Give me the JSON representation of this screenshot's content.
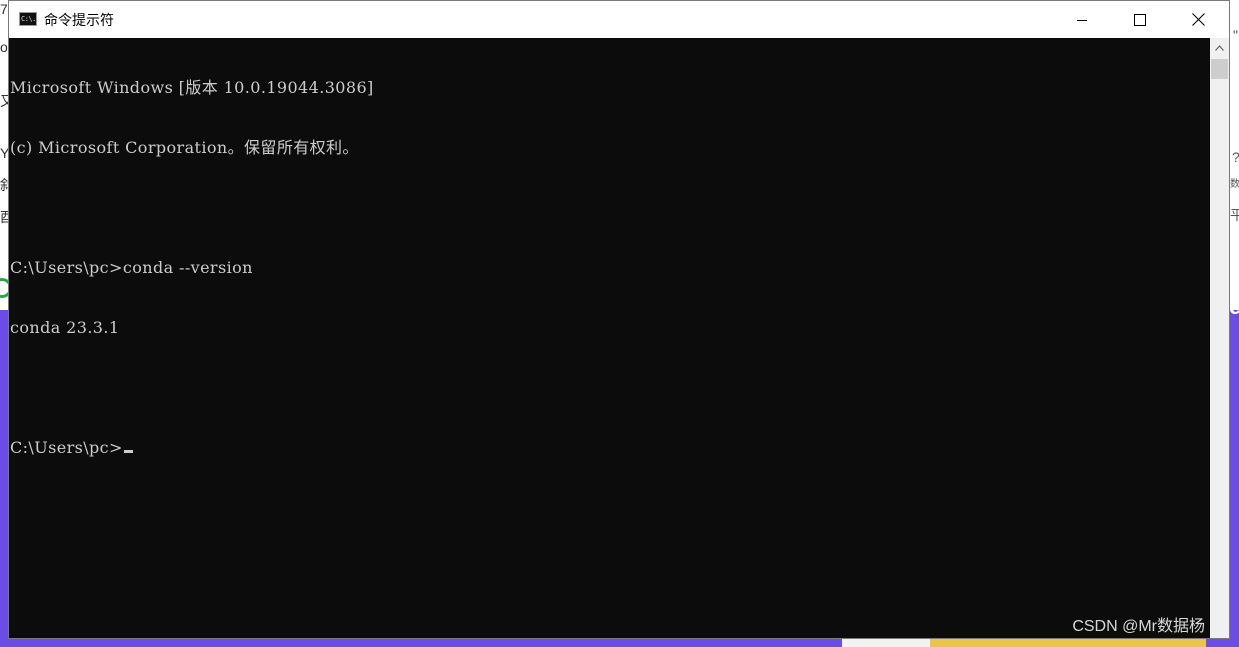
{
  "window": {
    "title": "命令提示符",
    "icon": "cmd-icon",
    "icon_text": "C:\\."
  },
  "caption_buttons": {
    "minimize_icon": "minimize-icon",
    "maximize_icon": "maximize-icon",
    "close_icon": "close-icon"
  },
  "console": {
    "lines": [
      "Microsoft Windows [版本 10.0.19044.3086]",
      "(c) Microsoft Corporation。保留所有权利。",
      "",
      "C:\\Users\\pc>conda --version",
      "conda 23.3.1",
      "",
      "C:\\Users\\pc>"
    ],
    "text_color": "#cccccc",
    "background_color": "#0c0c0c"
  },
  "watermark": "CSDN @Mr数据杨",
  "background": {
    "left_fragments": [
      "7",
      "o",
      "又",
      "Y",
      "斜",
      "酉"
    ],
    "right_fragments": [
      "\"",
      "?",
      "数",
      "平",
      "e"
    ],
    "accent_purple": "#6b4de6"
  }
}
